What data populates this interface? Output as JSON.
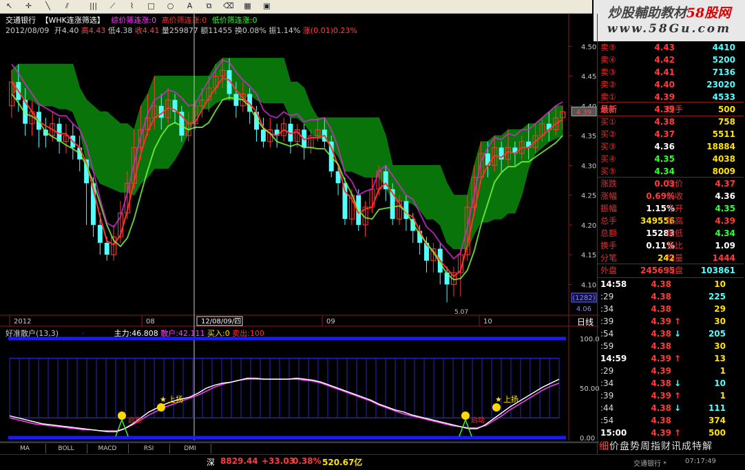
{
  "toolbar": {
    "icons": [
      "pointer-icon",
      "cross-icon",
      "line-icon",
      "channel-icon",
      "bars-icon",
      "fan-icon",
      "fibo-icon",
      "rect-icon",
      "ellipse-icon",
      "text-icon",
      "copy-icon",
      "eraser-icon",
      "color-icon",
      "save-icon"
    ]
  },
  "banner": {
    "line1_a": "炒股輔助教材",
    "line1_b": "58股网",
    "line2": "www.58Gu.com"
  },
  "header": {
    "stock_name": "交通银行",
    "formula": "【WHK连涨筛选】",
    "ind1": "综价筛连涨:0",
    "ind2": "高价筛连涨:0",
    "ind3": "低价筛连涨:0",
    "line2_date": "2012/08/09",
    "line2_open": "开4.40",
    "line2_high": "高4.43",
    "line2_low": "低4.38",
    "line2_close": "收4.41",
    "line2_vol": "量259877",
    "line2_amt": "额11455",
    "line2_turn": "换0.08%",
    "line2_amp": "振1.14%",
    "line2_chg": "涨(0.01)0.23%"
  },
  "chart": {
    "y_labels": [
      "4.50",
      "4.45",
      "4.40",
      "4.35",
      "4.30",
      "4.25",
      "4.20",
      "4.15",
      "4.10"
    ],
    "current_price": "4.39",
    "bottom_box1": "(1282)",
    "bottom_box2": "4.06",
    "low_label": "5.07",
    "x_labels": [
      "2012",
      "08",
      "09",
      "10"
    ],
    "cursor_date": "12/08/09/四",
    "period": "日线"
  },
  "chart_data": {
    "type": "candlestick",
    "note": "daily candles, values estimated",
    "ylim": [
      4.06,
      4.52
    ],
    "candles": [
      [
        4.4,
        4.44,
        4.38,
        4.46
      ],
      [
        4.44,
        4.41,
        4.39,
        4.47
      ],
      [
        4.41,
        4.37,
        4.35,
        4.43
      ],
      [
        4.37,
        4.39,
        4.35,
        4.41
      ],
      [
        4.39,
        4.36,
        4.33,
        4.4
      ],
      [
        4.36,
        4.35,
        4.33,
        4.38
      ],
      [
        4.35,
        4.37,
        4.34,
        4.39
      ],
      [
        4.37,
        4.34,
        4.32,
        4.38
      ],
      [
        4.34,
        4.35,
        4.32,
        4.37
      ],
      [
        4.35,
        4.33,
        4.31,
        4.37
      ],
      [
        4.33,
        4.31,
        4.29,
        4.35
      ],
      [
        4.31,
        4.27,
        4.2,
        4.31
      ],
      [
        4.27,
        4.2,
        4.18,
        4.28
      ],
      [
        4.2,
        4.17,
        4.15,
        4.22
      ],
      [
        4.17,
        4.15,
        4.14,
        4.18
      ],
      [
        4.15,
        4.18,
        4.14,
        4.2
      ],
      [
        4.18,
        4.22,
        4.17,
        4.24
      ],
      [
        4.22,
        4.27,
        4.21,
        4.29
      ],
      [
        4.27,
        4.33,
        4.26,
        4.36
      ],
      [
        4.33,
        4.36,
        4.31,
        4.4
      ],
      [
        4.36,
        4.38,
        4.35,
        4.42
      ],
      [
        4.38,
        4.4,
        4.36,
        4.45
      ],
      [
        4.4,
        4.38,
        4.36,
        4.42
      ],
      [
        4.38,
        4.41,
        4.37,
        4.43
      ],
      [
        4.41,
        4.39,
        4.37,
        4.42
      ],
      [
        4.39,
        4.35,
        4.34,
        4.4
      ],
      [
        4.35,
        4.37,
        4.34,
        4.39
      ],
      [
        4.37,
        4.4,
        4.36,
        4.41
      ],
      [
        4.4,
        4.41,
        4.38,
        4.43
      ],
      [
        4.41,
        4.43,
        4.39,
        4.45
      ],
      [
        4.43,
        4.45,
        4.42,
        4.47
      ],
      [
        4.45,
        4.46,
        4.43,
        4.48
      ],
      [
        4.46,
        4.42,
        4.41,
        4.48
      ],
      [
        4.42,
        4.4,
        4.38,
        4.44
      ],
      [
        4.4,
        4.42,
        4.39,
        4.44
      ],
      [
        4.42,
        4.39,
        4.37,
        4.43
      ],
      [
        4.39,
        4.36,
        4.34,
        4.4
      ],
      [
        4.36,
        4.34,
        4.33,
        4.38
      ],
      [
        4.34,
        4.36,
        4.33,
        4.38
      ],
      [
        4.36,
        4.35,
        4.33,
        4.37
      ],
      [
        4.35,
        4.37,
        4.34,
        4.38
      ],
      [
        4.37,
        4.34,
        4.32,
        4.38
      ],
      [
        4.34,
        4.36,
        4.33,
        4.37
      ],
      [
        4.36,
        4.33,
        4.31,
        4.37
      ],
      [
        4.33,
        4.35,
        4.32,
        4.36
      ],
      [
        4.35,
        4.36,
        4.34,
        4.38
      ],
      [
        4.36,
        4.34,
        4.33,
        4.38
      ],
      [
        4.34,
        4.29,
        4.28,
        4.35
      ],
      [
        4.29,
        4.27,
        4.25,
        4.3
      ],
      [
        4.27,
        4.21,
        4.2,
        4.28
      ],
      [
        4.21,
        4.25,
        4.2,
        4.26
      ],
      [
        4.25,
        4.2,
        4.19,
        4.26
      ],
      [
        4.2,
        4.23,
        4.18,
        4.24
      ],
      [
        4.23,
        4.26,
        4.22,
        4.28
      ],
      [
        4.26,
        4.29,
        4.25,
        4.3
      ],
      [
        4.29,
        4.26,
        4.24,
        4.3
      ],
      [
        4.26,
        4.21,
        4.2,
        4.27
      ],
      [
        4.21,
        4.24,
        4.2,
        4.25
      ],
      [
        4.24,
        4.21,
        4.19,
        4.25
      ],
      [
        4.21,
        4.19,
        4.17,
        4.22
      ],
      [
        4.19,
        4.17,
        4.15,
        4.2
      ],
      [
        4.17,
        4.14,
        4.12,
        4.18
      ],
      [
        4.14,
        4.16,
        4.12,
        4.17
      ],
      [
        4.16,
        4.12,
        4.1,
        4.17
      ],
      [
        4.12,
        4.1,
        4.07,
        4.13
      ],
      [
        4.1,
        4.12,
        4.08,
        4.13
      ],
      [
        4.12,
        4.15,
        4.08,
        4.16
      ],
      [
        4.15,
        4.23,
        4.14,
        4.25
      ],
      [
        4.23,
        4.28,
        4.22,
        4.3
      ],
      [
        4.28,
        4.32,
        4.27,
        4.34
      ],
      [
        4.32,
        4.3,
        4.28,
        4.34
      ],
      [
        4.3,
        4.33,
        4.29,
        4.35
      ],
      [
        4.33,
        4.31,
        4.29,
        4.34
      ],
      [
        4.31,
        4.33,
        4.3,
        4.36
      ],
      [
        4.33,
        4.32,
        4.3,
        4.34
      ],
      [
        4.32,
        4.34,
        4.31,
        4.35
      ],
      [
        4.34,
        4.33,
        4.31,
        4.37
      ],
      [
        4.33,
        4.35,
        4.32,
        4.37
      ],
      [
        4.35,
        4.37,
        4.34,
        4.38
      ],
      [
        4.37,
        4.36,
        4.34,
        4.39
      ],
      [
        4.36,
        4.38,
        4.35,
        4.4
      ],
      [
        4.38,
        4.39,
        4.36,
        4.4
      ]
    ]
  },
  "indicator": {
    "name": "好准散户(13,3)",
    "v1": "主力:46.808",
    "v2": "散户:42.111",
    "v3": "买入:0",
    "v4": "卖出:100",
    "y_labels": [
      "100.00",
      "50.00",
      "0.00"
    ],
    "buy_label": "启动",
    "up_label": "上扬",
    "zhuli": [
      22,
      20,
      18,
      16,
      14,
      13,
      12,
      11,
      10,
      9,
      8,
      7,
      6,
      6,
      9,
      14,
      20,
      26,
      30,
      34,
      37,
      39,
      41,
      45,
      50,
      53,
      55,
      56,
      58,
      60,
      60,
      59,
      59,
      59,
      59,
      60,
      59,
      58,
      56,
      53,
      50,
      47,
      44,
      41,
      38,
      34,
      31,
      28,
      26,
      23,
      21,
      19,
      17,
      15,
      13,
      11,
      9,
      9,
      13,
      19,
      25,
      31,
      36,
      41,
      46,
      51,
      55,
      59
    ],
    "sanhu": [
      20,
      18,
      16,
      14,
      13,
      12,
      11,
      10,
      9,
      8,
      8,
      7,
      7,
      7,
      9,
      13,
      18,
      23,
      27,
      31,
      34,
      37,
      40,
      43,
      47,
      51,
      54,
      56,
      58,
      59,
      59,
      59,
      59,
      59,
      59,
      59,
      58,
      57,
      55,
      52,
      49,
      46,
      43,
      40,
      37,
      33,
      30,
      27,
      24,
      22,
      20,
      18,
      16,
      14,
      12,
      11,
      10,
      10,
      12,
      17,
      22,
      28,
      33,
      38,
      43,
      48,
      52,
      55
    ]
  },
  "tabs": [
    "MA",
    "BOLL",
    "MACD",
    "RSI",
    "DMI"
  ],
  "statusbar": {
    "index": "8829.44",
    "chg": "+33.03",
    "pct": "0.38%",
    "amt": "520.67亿",
    "tail": "交通银行 *",
    "time": "07:17:49",
    "prefix": "深"
  },
  "orderbook": {
    "sell": [
      [
        "卖⑤",
        "4.43",
        "4410"
      ],
      [
        "卖④",
        "4.42",
        "5200"
      ],
      [
        "卖③",
        "4.41",
        "7136"
      ],
      [
        "卖②",
        "4.40",
        "23020"
      ],
      [
        "卖①",
        "4.39",
        "4533"
      ]
    ],
    "latest": {
      "label": "最新",
      "price": "4.39",
      "label2": "现手",
      "vol": "500"
    },
    "buy": [
      [
        "买①",
        "4.38",
        "758"
      ],
      [
        "买②",
        "4.37",
        "5511"
      ],
      [
        "买③",
        "4.36",
        "18884"
      ],
      [
        "买④",
        "4.35",
        "4038"
      ],
      [
        "买⑤",
        "4.34",
        "8009"
      ]
    ],
    "stats": [
      [
        "涨跌",
        "0.03",
        "均价",
        "4.37"
      ],
      [
        "涨幅",
        "0.69%",
        "前收",
        "4.36"
      ],
      [
        "振幅",
        "1.15%",
        "今开",
        "4.35"
      ],
      [
        "总手",
        "349556",
        "最高",
        "4.39"
      ],
      [
        "总额",
        "15283",
        "最低",
        "4.34"
      ],
      [
        "换手",
        "0.11%",
        "量比",
        "1.09"
      ],
      [
        "分笔",
        "242",
        "均量",
        "1444"
      ]
    ],
    "outer": {
      "l1": "外盘",
      "v1": "245695",
      "l2": "内盘",
      "v2": "103861"
    }
  },
  "ticks": [
    {
      "t": "14:58",
      "p": "4.38",
      "a": "",
      "v": "10",
      "hour": true
    },
    {
      "t": ":29",
      "p": "4.38",
      "a": "",
      "v": "225"
    },
    {
      "t": ":34",
      "p": "4.38",
      "a": "",
      "v": "29"
    },
    {
      "t": ":39",
      "p": "4.39",
      "a": "↑",
      "v": "30"
    },
    {
      "t": ":54",
      "p": "4.38",
      "a": "↓",
      "v": "205"
    },
    {
      "t": ":59",
      "p": "4.38",
      "a": "",
      "v": "30"
    },
    {
      "t": "14:59",
      "p": "4.39",
      "a": "↑",
      "v": "13",
      "hour": true
    },
    {
      "t": ":29",
      "p": "4.39",
      "a": "",
      "v": "1"
    },
    {
      "t": ":34",
      "p": "4.38",
      "a": "↓",
      "v": "10"
    },
    {
      "t": ":39",
      "p": "4.39",
      "a": "↑",
      "v": "1"
    },
    {
      "t": ":44",
      "p": "4.38",
      "a": "↓",
      "v": "111"
    },
    {
      "t": ":54",
      "p": "4.38",
      "a": "",
      "v": "374"
    },
    {
      "t": "15:00",
      "p": "4.39",
      "a": "↑",
      "v": "500",
      "hour": true
    }
  ],
  "footer_tabs": {
    "a": "细",
    "b": "价",
    "c": "盘",
    "d": "势",
    "e": "周",
    "f": "指",
    "g": "财",
    "h": "讯",
    "i": "成",
    "j": "特",
    "k": "解"
  }
}
